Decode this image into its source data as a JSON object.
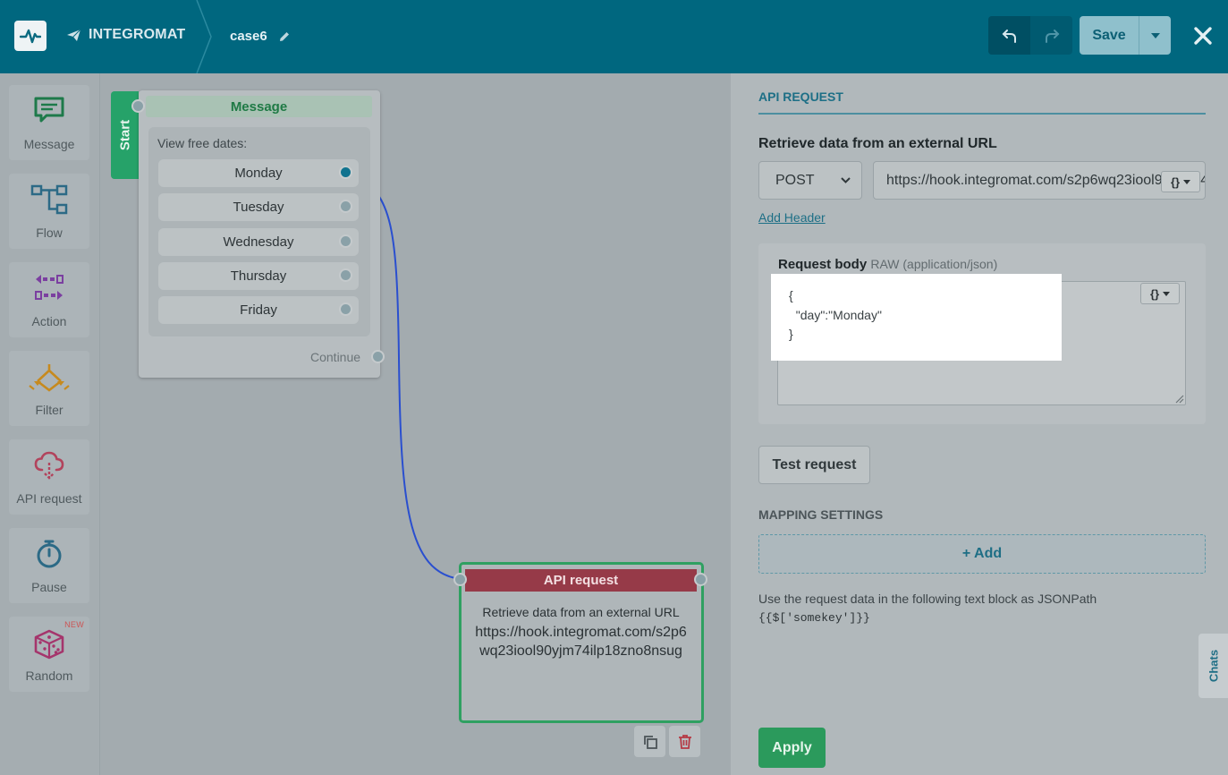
{
  "header": {
    "brand": "INTEGROMAT",
    "scenario_name": "case6",
    "save_label": "Save"
  },
  "sidebar": {
    "items": [
      {
        "label": "Message",
        "icon": "message-icon"
      },
      {
        "label": "Flow",
        "icon": "flow-icon"
      },
      {
        "label": "Action",
        "icon": "action-icon"
      },
      {
        "label": "Filter",
        "icon": "filter-icon"
      },
      {
        "label": "API request",
        "icon": "cloud-api-icon"
      },
      {
        "label": "Pause",
        "icon": "timer-icon"
      },
      {
        "label": "Random",
        "icon": "dice-icon",
        "badge": "NEW"
      }
    ]
  },
  "canvas": {
    "message_node": {
      "start_label": "Start",
      "title": "Message",
      "prompt": "View free dates:",
      "options": [
        "Monday",
        "Tuesday",
        "Wednesday",
        "Thursday",
        "Friday"
      ],
      "continue_label": "Continue"
    },
    "api_node": {
      "title": "API request",
      "description": "Retrieve data from an external URL",
      "url": "https://hook.integromat.com/s2p6wq23iool90yjm74ilp18zno8nsug"
    }
  },
  "panel": {
    "section_title": "API REQUEST",
    "subtitle": "Retrieve data from an external URL",
    "method": "POST",
    "url": "https://hook.integromat.com/s2p6wq23iool90yjm74ilp18zno8nsug",
    "add_header_label": "Add Header",
    "request_body_label": "Request body",
    "request_body_type": "RAW (application/json)",
    "request_body_code": "{\n  \"day\":\"Monday\"\n}",
    "test_request_label": "Test request",
    "mapping_title": "MAPPING SETTINGS",
    "add_label": "+ Add",
    "hint_text": "Use the request data in the following text block as JSONPath",
    "hint_code": "{{$['somekey']}}",
    "chats_label": "Chats",
    "apply_label": "Apply"
  },
  "colors": {
    "topbar": "#00677f",
    "accent_green": "#2b9a5c",
    "api_red": "#963a48",
    "link_blue": "#1d6f86",
    "connector_blue": "#2a4fcf"
  }
}
